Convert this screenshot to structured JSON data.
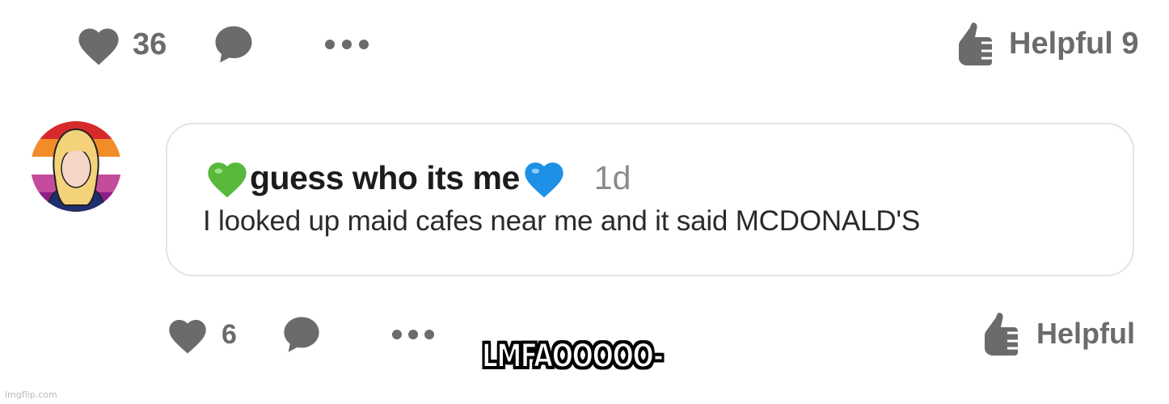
{
  "top_actions": {
    "like_count": "36",
    "helpful_label": "Helpful 9"
  },
  "comment": {
    "username": "guess who its me",
    "timestamp": "1d",
    "body": "I looked up maid cafes near me and it said MCDONALD'S"
  },
  "reply_actions": {
    "like_count": "6",
    "helpful_label": "Helpful"
  },
  "caption": "LMFAOOOOO-",
  "watermark": "imgflip.com",
  "icons": {
    "like": "heart-icon",
    "comment": "speech-bubble-icon",
    "more": "more-dots-icon",
    "helpful": "thumbs-up-icon",
    "username_prefix": "green-heart-emoji",
    "username_suffix": "blue-heart-emoji"
  },
  "colors": {
    "icon_gray": "#6b6b6b",
    "green_heart": "#58b83c",
    "blue_heart": "#1e90e6"
  }
}
